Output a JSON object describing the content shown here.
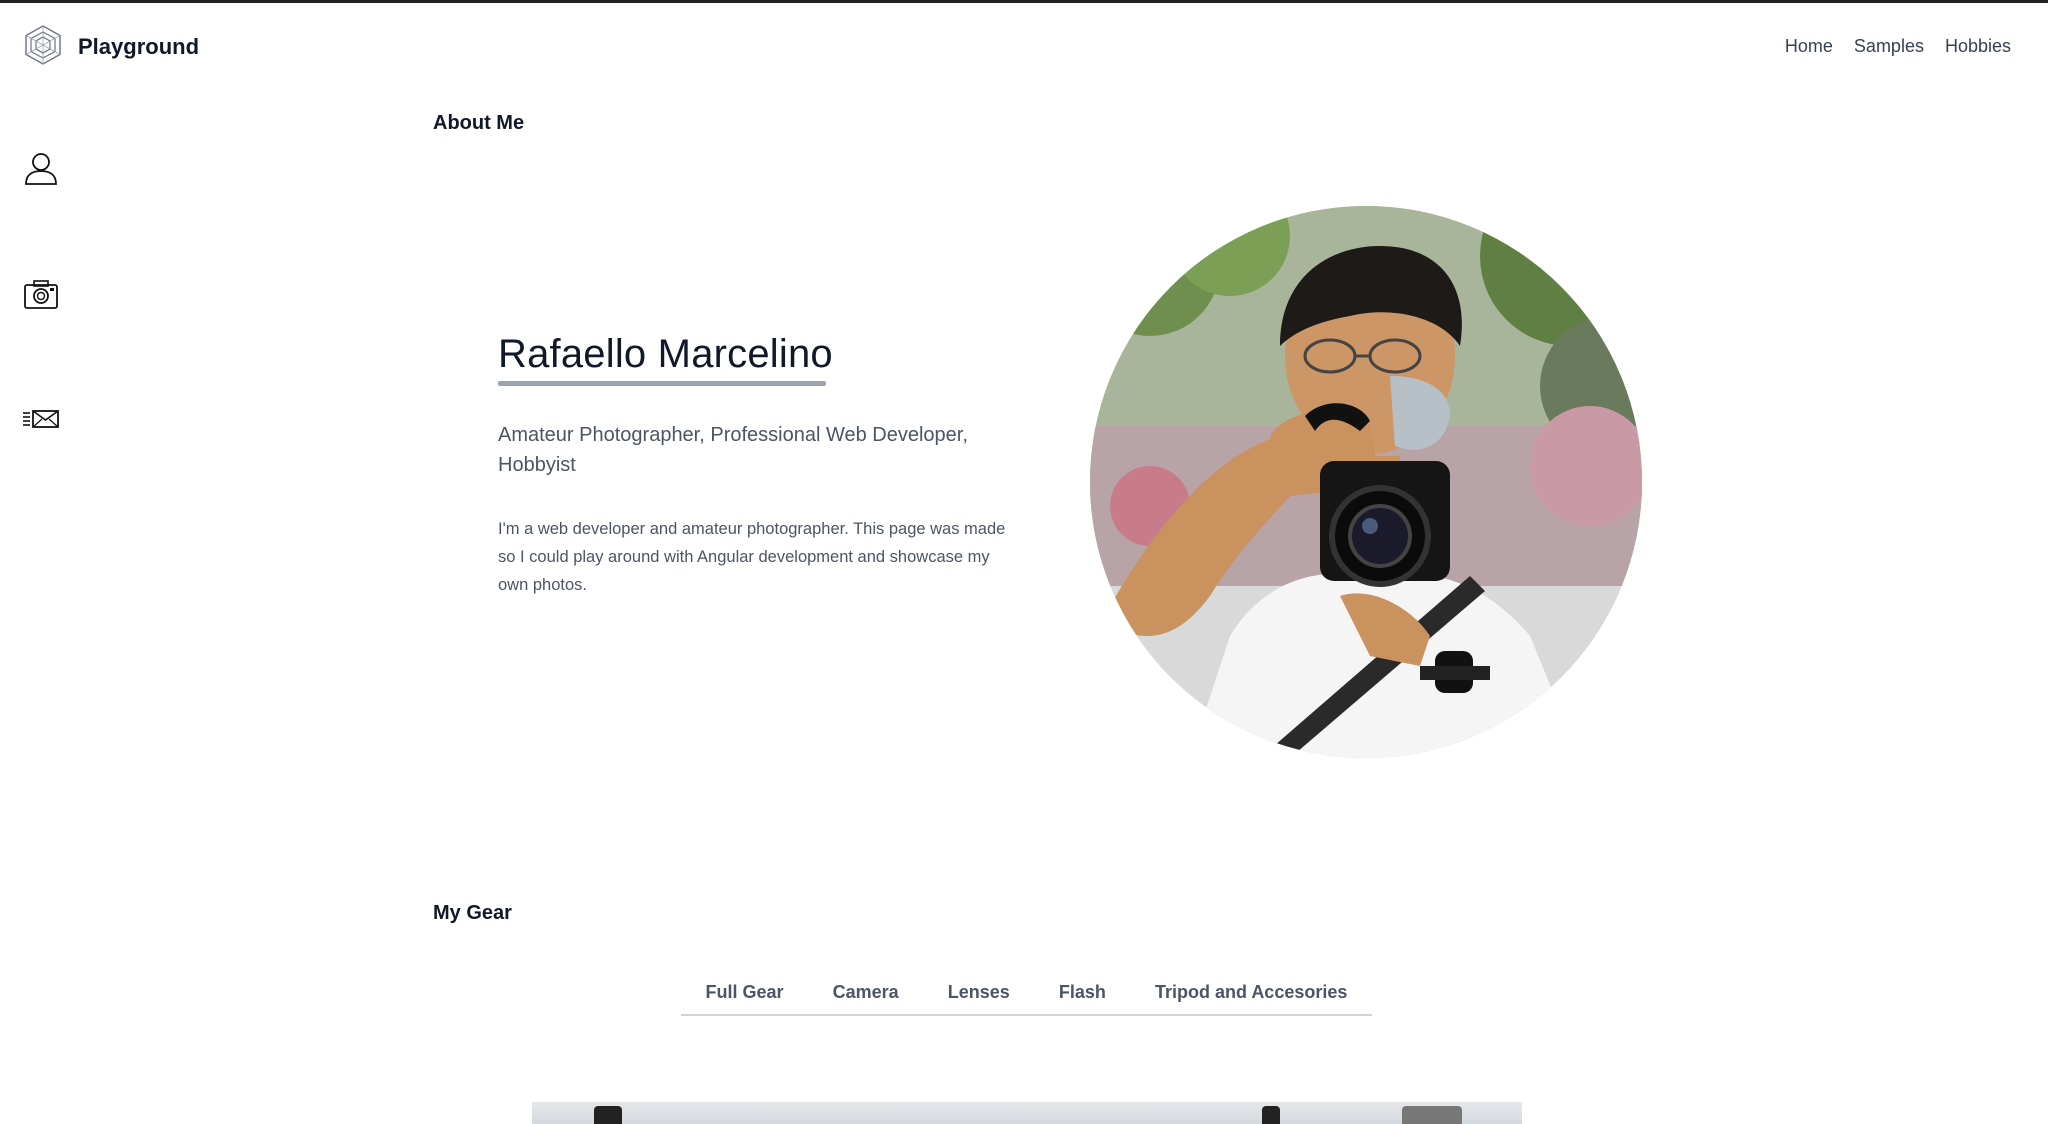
{
  "header": {
    "brand": "Playground",
    "nav": {
      "home": "Home",
      "samples": "Samples",
      "hobbies": "Hobbies"
    }
  },
  "sidebar": {
    "icons": [
      "user-icon",
      "camera-icon",
      "mail-icon"
    ]
  },
  "about": {
    "section_title": "About Me",
    "name": "Rafaello Marcelino",
    "subtitle": "Amateur Photographer, Professional Web Developer, Hobbyist",
    "bio": "I'm a web developer and amateur photographer. This page was made so I could play around with Angular development and showcase my own photos."
  },
  "gear": {
    "section_title": "My Gear",
    "tabs": [
      "Full Gear",
      "Camera",
      "Lenses",
      "Flash",
      "Tripod and Accesories"
    ]
  },
  "colors": {
    "text_primary": "#111827",
    "text_secondary": "#4b5563",
    "underline": "#9ca3af"
  }
}
